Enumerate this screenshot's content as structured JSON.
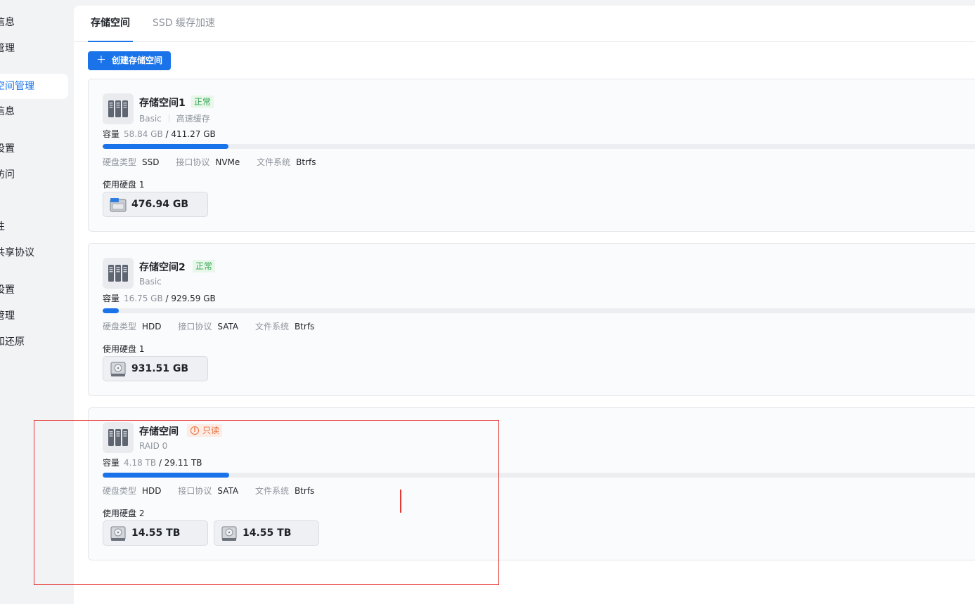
{
  "sidebar": {
    "items": [
      {
        "label": "信息"
      },
      {
        "label": "管理"
      },
      {
        "label": "空间管理"
      },
      {
        "label": "信息"
      },
      {
        "label": "设置"
      },
      {
        "label": "访问"
      },
      {
        "label": "性"
      },
      {
        "label": "共享协议"
      },
      {
        "label": "设置"
      },
      {
        "label": "管理"
      },
      {
        "label": "和还原"
      }
    ]
  },
  "tabs": [
    {
      "label": "存储空间"
    },
    {
      "label": "SSD 缓存加速"
    }
  ],
  "create_button": {
    "label": "创建存储空间",
    "icon": "plus-icon"
  },
  "labels": {
    "capacity": "容量",
    "disk_type": "硬盘类型",
    "interface": "接口协议",
    "filesystem": "文件系统",
    "disks_used": "使用硬盘"
  },
  "colors": {
    "accent": "#1a73e8",
    "ok": "#34a853",
    "warn": "#e8703a"
  },
  "pools": [
    {
      "name": "存储空间1",
      "status": "正常",
      "status_kind": "ok",
      "raid": "Basic",
      "extra": "高速缓存",
      "used": "58.84 GB",
      "total": "/ 411.27 GB",
      "usage_fraction": 0.143,
      "disk_type": "SSD",
      "interface": "NVMe",
      "filesystem": "Btrfs",
      "disk_count": "1",
      "disks": [
        {
          "size": "476.94 GB",
          "icon": "nvme-ssd-icon"
        }
      ]
    },
    {
      "name": "存储空间2",
      "status": "正常",
      "status_kind": "ok",
      "raid": "Basic",
      "extra": "",
      "used": "16.75 GB",
      "total": "/ 929.59 GB",
      "usage_fraction": 0.018,
      "disk_type": "HDD",
      "interface": "SATA",
      "filesystem": "Btrfs",
      "disk_count": "1",
      "disks": [
        {
          "size": "931.51 GB",
          "icon": "hdd-icon"
        }
      ]
    },
    {
      "name": "存储空间",
      "status": "只读",
      "status_kind": "readonly",
      "raid": "RAID 0",
      "extra": "",
      "used": "4.18 TB",
      "total": "/ 29.11 TB",
      "usage_fraction": 0.144,
      "disk_type": "HDD",
      "interface": "SATA",
      "filesystem": "Btrfs",
      "disk_count": "2",
      "disks": [
        {
          "size": "14.55 TB",
          "icon": "hdd-icon"
        },
        {
          "size": "14.55 TB",
          "icon": "hdd-icon"
        }
      ]
    }
  ]
}
